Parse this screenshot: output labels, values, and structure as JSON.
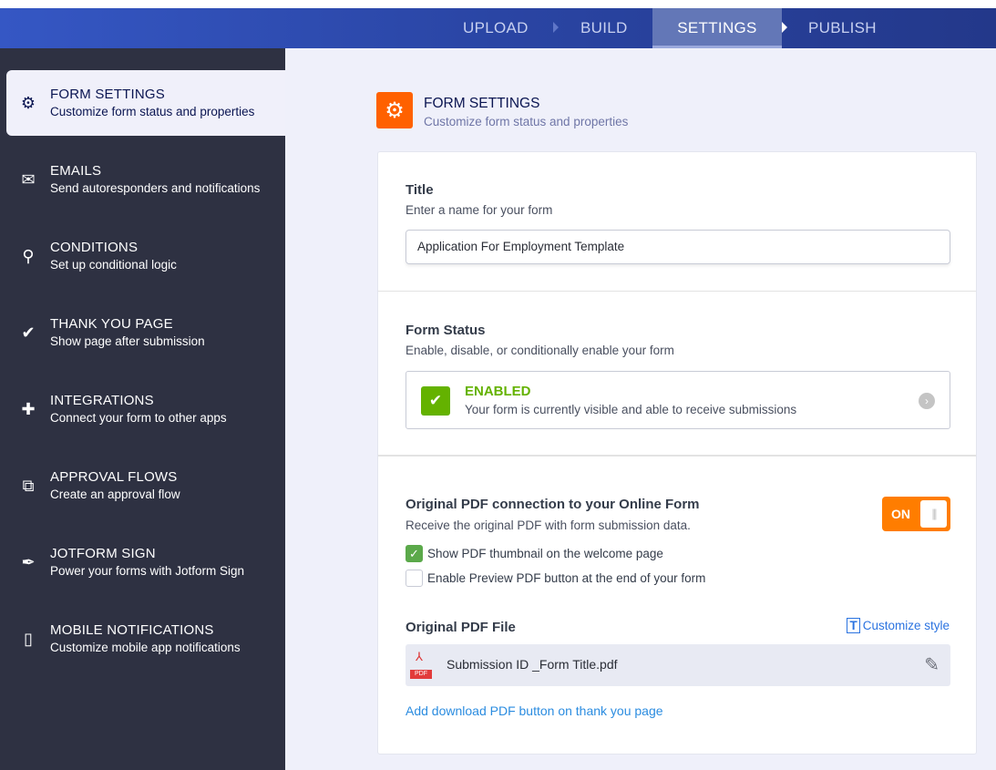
{
  "nav": {
    "tabs": [
      "UPLOAD",
      "BUILD",
      "SETTINGS",
      "PUBLISH"
    ],
    "active": "SETTINGS"
  },
  "sidebar": {
    "items": [
      {
        "title": "FORM SETTINGS",
        "subtitle": "Customize form status and properties",
        "icon": "gear-icon"
      },
      {
        "title": "EMAILS",
        "subtitle": "Send autoresponders and notifications",
        "icon": "envelope-icon"
      },
      {
        "title": "CONDITIONS",
        "subtitle": "Set up conditional logic",
        "icon": "conditions-icon"
      },
      {
        "title": "THANK YOU PAGE",
        "subtitle": "Show page after submission",
        "icon": "check-circle-icon"
      },
      {
        "title": "INTEGRATIONS",
        "subtitle": "Connect your form to other apps",
        "icon": "puzzle-icon"
      },
      {
        "title": "APPROVAL FLOWS",
        "subtitle": "Create an approval flow",
        "icon": "approval-icon"
      },
      {
        "title": "JOTFORM SIGN",
        "subtitle": "Power your forms with Jotform Sign",
        "icon": "sign-pen-icon"
      },
      {
        "title": "MOBILE NOTIFICATIONS",
        "subtitle": "Customize mobile app notifications",
        "icon": "mobile-icon"
      }
    ]
  },
  "page": {
    "title": "FORM SETTINGS",
    "subtitle": "Customize form status and properties",
    "accent": "#ff6100"
  },
  "title_section": {
    "label": "Title",
    "help": "Enter a name for your form",
    "value": "Application For Employment Template"
  },
  "status_section": {
    "label": "Form Status",
    "help": "Enable, disable, or conditionally enable your form",
    "status": "ENABLED",
    "status_desc": "Your form is currently visible and able to receive submissions",
    "status_color": "#64b200"
  },
  "pdf_section": {
    "label": "Original PDF connection to your Online Form",
    "help": "Receive the original PDF with form submission data.",
    "toggle": "ON",
    "checkboxes": [
      {
        "label": "Show PDF thumbnail on the welcome page",
        "checked": true
      },
      {
        "label": "Enable Preview PDF button at the end of your form",
        "checked": false
      }
    ],
    "file_label": "Original PDF File",
    "customize": "Customize style",
    "file_tag": "PDF",
    "file_name": "Submission ID _Form Title.pdf",
    "download_link": "Add download PDF button on thank you page"
  }
}
